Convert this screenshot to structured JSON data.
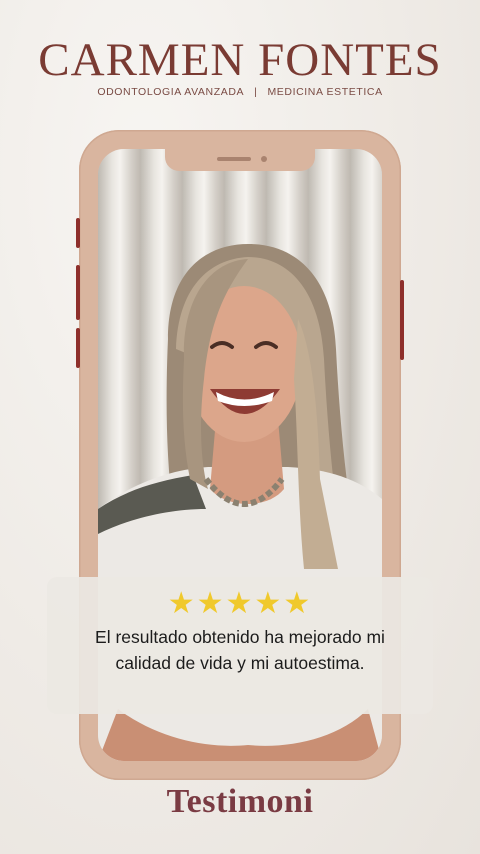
{
  "header": {
    "brand": "CARMEN FONTES",
    "subtitle_left": "ODONTOLOGIA AVANZADA",
    "subtitle_sep": "|",
    "subtitle_right": "MEDICINA ESTETICA"
  },
  "review": {
    "rating": 5,
    "stars": "★★★★★",
    "quote": "El resultado obtenido ha mejorado mi calidad de vida y mi autoestima."
  },
  "footer": {
    "label": "Testimoni"
  },
  "colors": {
    "brand": "#7a3b33",
    "phone_frame": "#d9b59f",
    "side_buttons": "#8e2f2b",
    "stars": "#f0c92c",
    "footer": "#7a3b43"
  }
}
